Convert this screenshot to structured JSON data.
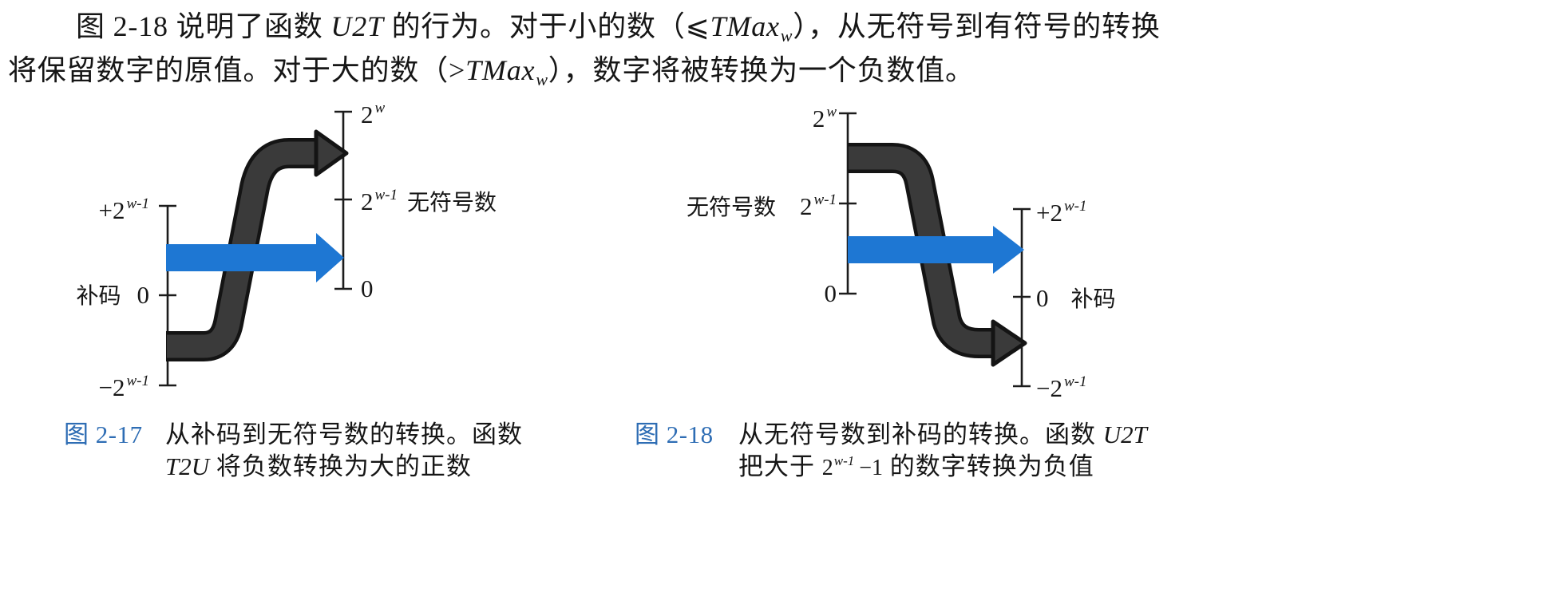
{
  "paragraph": {
    "line1": {
      "a": "图 2-18 说明了函数 ",
      "fn": "U2T",
      "b": " 的行为。对于小的数（⩽",
      "tmax": "TMax",
      "tmax_sub": "w",
      "c": "），从无符号到有符号的转换"
    },
    "line2": {
      "a": "将保留数字的原值。对于大的数（>",
      "tmax": "TMax",
      "tmax_sub": "w",
      "b": "），数字将被转换为一个负数值。"
    }
  },
  "fig17": {
    "twos_axis": {
      "name": "补码",
      "ticks": [
        {
          "base": "+2",
          "sup": "w-1"
        },
        {
          "base": "0"
        },
        {
          "base": "−2",
          "sup": "w-1"
        }
      ]
    },
    "unsigned_axis": {
      "name": "无符号数",
      "ticks": [
        {
          "base": "2",
          "sup": "w"
        },
        {
          "base": "2",
          "sup": "w-1"
        },
        {
          "base": "0"
        }
      ]
    },
    "caption": {
      "label": "图 2-17",
      "line1": "从补码到无符号数的转换。函数",
      "fn": "T2U",
      "line2": " 将负数转换为大的正数"
    }
  },
  "fig18": {
    "unsigned_axis": {
      "name": "无符号数",
      "ticks": [
        {
          "base": "2",
          "sup": "w"
        },
        {
          "base": "2",
          "sup": "w-1"
        },
        {
          "base": "0"
        }
      ]
    },
    "twos_axis": {
      "name": "补码",
      "ticks": [
        {
          "base": "+2",
          "sup": "w-1"
        },
        {
          "base": "0"
        },
        {
          "base": "−2",
          "sup": "w-1"
        }
      ]
    },
    "caption": {
      "label": "图 2-18",
      "line1": "从无符号数到补码的转换。函数 ",
      "fn": "U2T",
      "line2_a": "把大于 ",
      "line2_base": "2",
      "line2_sup": "w-1",
      "line2_b": "−1",
      "line2_c": " 的数字转换为负值"
    }
  },
  "colors": {
    "text": "#161616",
    "caption_label": "#2e6db4",
    "blue_arrow": "#1e77d3",
    "black_arrow_fill": "#3a3a3a",
    "black_arrow_edge": "#141414"
  }
}
